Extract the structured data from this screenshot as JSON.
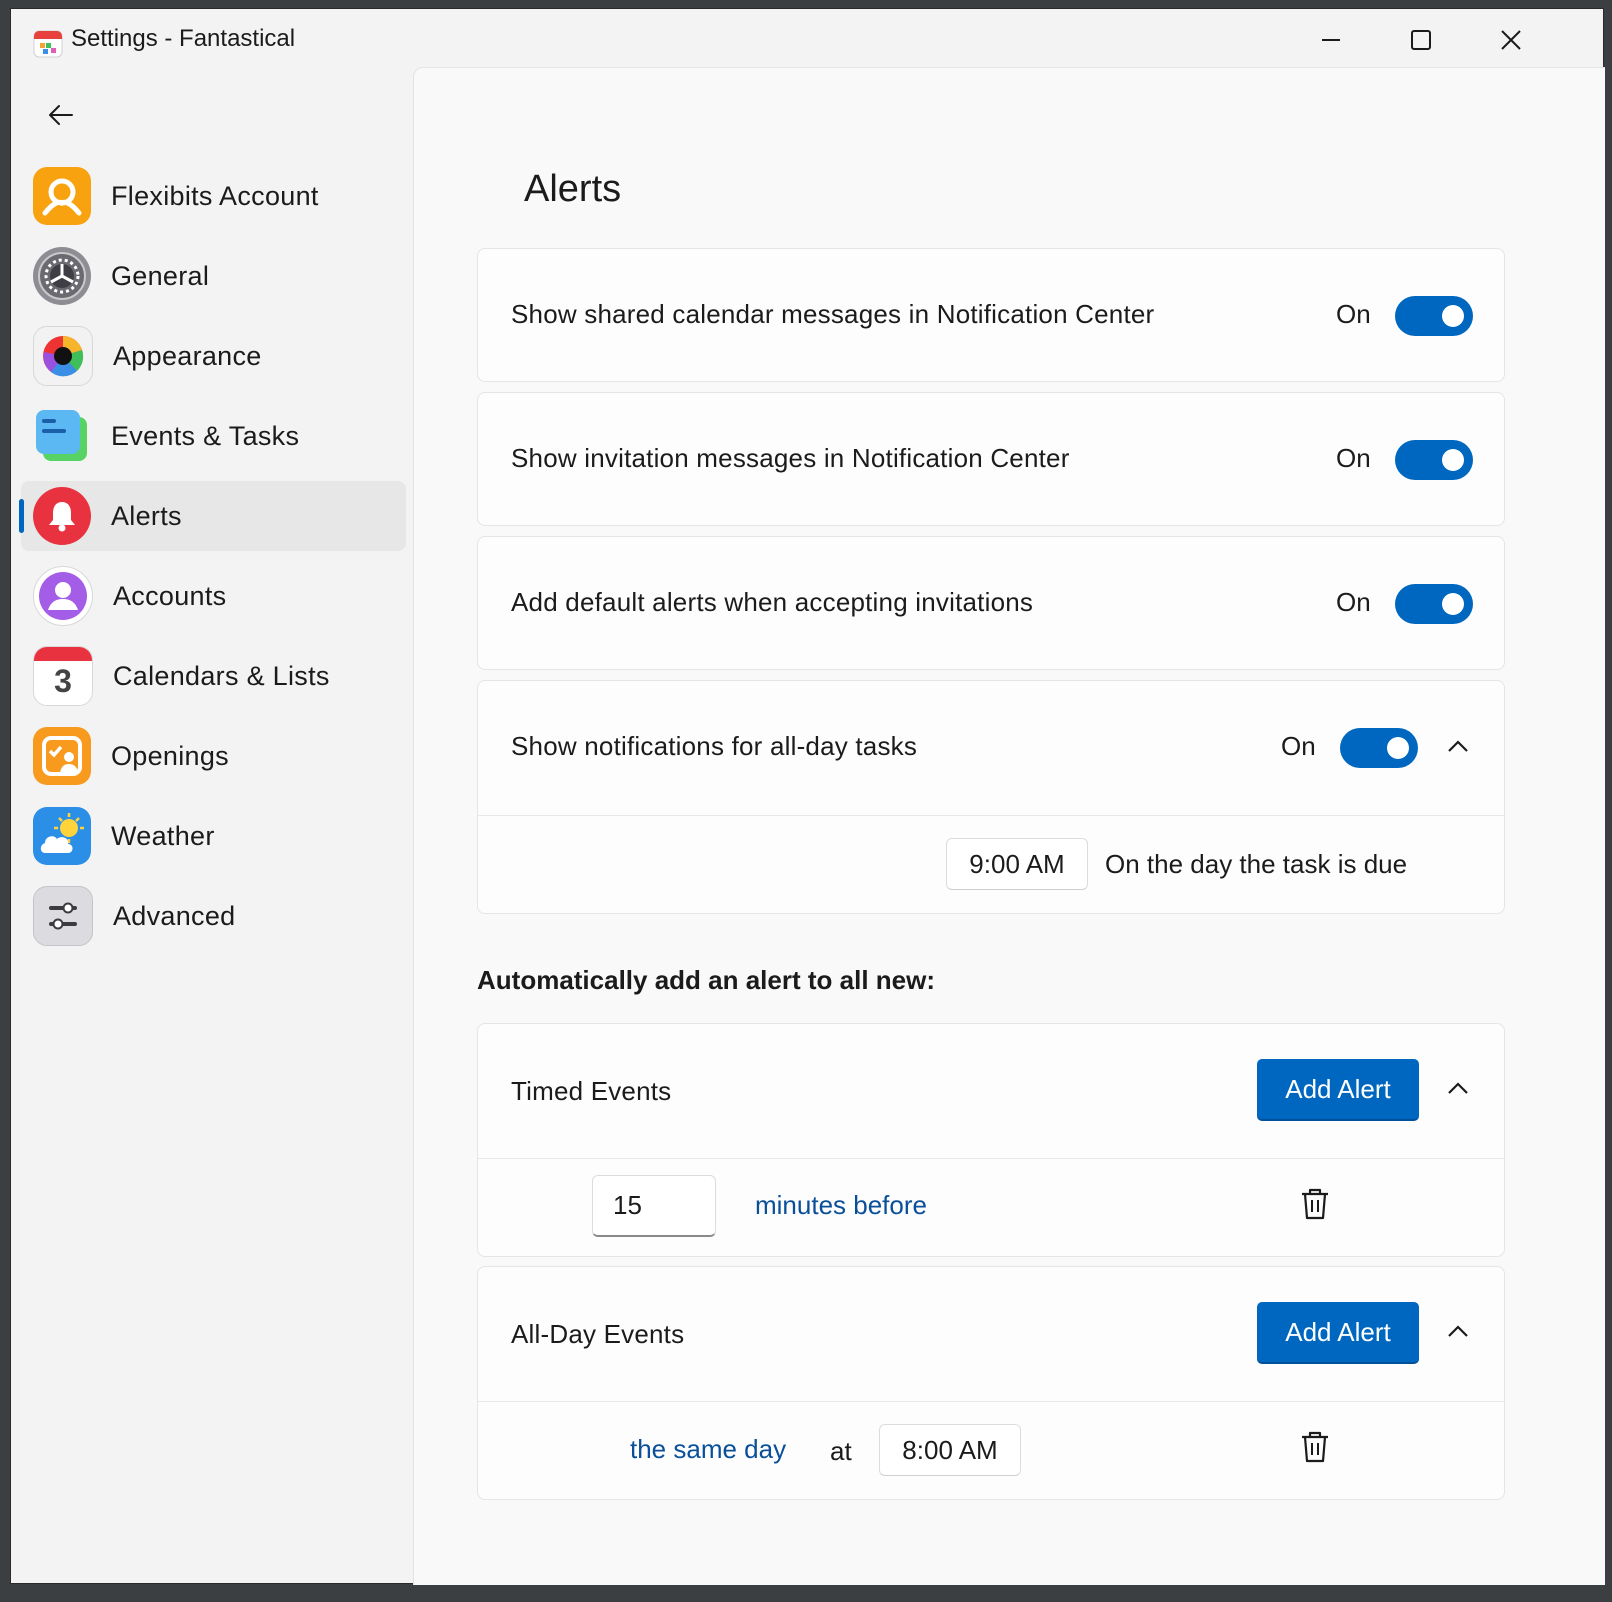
{
  "window": {
    "title": "Settings - Fantastical",
    "controls": [
      "minimize-icon",
      "maximize-icon",
      "close-icon"
    ]
  },
  "sidebar": {
    "back_icon": "arrow-left-icon",
    "items": [
      {
        "label": "Flexibits Account",
        "icon": "flexibits-account-icon",
        "active": false
      },
      {
        "label": "General",
        "icon": "gear-icon",
        "active": false
      },
      {
        "label": "Appearance",
        "icon": "color-wheel-icon",
        "active": false
      },
      {
        "label": "Events & Tasks",
        "icon": "events-tasks-icon",
        "active": false
      },
      {
        "label": "Alerts",
        "icon": "bell-icon",
        "active": true
      },
      {
        "label": "Accounts",
        "icon": "person-icon",
        "active": false
      },
      {
        "label": "Calendars & Lists",
        "icon": "calendar-icon",
        "active": false
      },
      {
        "label": "Openings",
        "icon": "openings-icon",
        "active": false
      },
      {
        "label": "Weather",
        "icon": "weather-icon",
        "active": false
      },
      {
        "label": "Advanced",
        "icon": "sliders-icon",
        "active": false
      }
    ],
    "calendar_icon_day": "3"
  },
  "main": {
    "title": "Alerts",
    "settings": [
      {
        "label": "Show shared calendar messages in Notification Center",
        "state": "On",
        "checked": true
      },
      {
        "label": "Show invitation messages in Notification Center",
        "state": "On",
        "checked": true
      },
      {
        "label": "Add default alerts when accepting invitations",
        "state": "On",
        "checked": true
      },
      {
        "label": "Show notifications for all-day tasks",
        "state": "On",
        "checked": true
      }
    ],
    "all_day_tasks_detail": {
      "time": "9:00 AM",
      "description": "On the day the task is due"
    },
    "auto_alert_heading": "Automatically add an alert to all new:",
    "timed_events": {
      "label": "Timed Events",
      "button": "Add Alert",
      "alert": {
        "amount": "15",
        "unit": "minutes before"
      }
    },
    "all_day_events": {
      "label": "All-Day Events",
      "button": "Add Alert",
      "alert": {
        "day": "the same day",
        "at": "at",
        "time": "8:00 AM"
      }
    }
  },
  "colors": {
    "accent": "#0067c0",
    "link": "#0a4f99",
    "sidebar_active": "#e7e7e7"
  }
}
